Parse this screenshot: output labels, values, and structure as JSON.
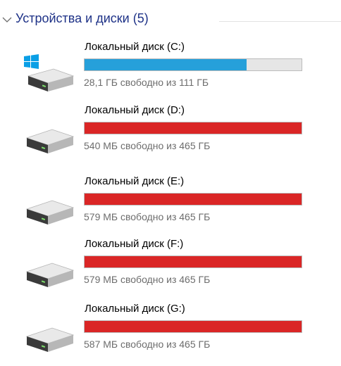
{
  "group": {
    "title": "Устройства и диски (5)",
    "expanded": true
  },
  "colors": {
    "bar_normal": "#26a0da",
    "bar_critical": "#da2626",
    "bar_track": "#e6e6e6",
    "group_title": "#1e3287",
    "free_text": "#6d6d6d"
  },
  "drives": [
    {
      "label": "Локальный диск (C:)",
      "free_text": "28,1 ГБ свободно из 111 ГБ",
      "used_fraction": 0.747,
      "status": "normal",
      "icon": "windows-system-drive-icon"
    },
    {
      "label": "Локальный диск (D:)",
      "free_text": "540 МБ свободно из 465 ГБ",
      "used_fraction": 0.999,
      "status": "critical",
      "icon": "hard-drive-icon"
    },
    {
      "label": "Локальный диск (E:)",
      "free_text": "579 МБ свободно из 465 ГБ",
      "used_fraction": 0.999,
      "status": "critical",
      "icon": "hard-drive-icon"
    },
    {
      "label": "Локальный диск (F:)",
      "free_text": "579 МБ свободно из 465 ГБ",
      "used_fraction": 0.999,
      "status": "critical",
      "icon": "hard-drive-icon"
    },
    {
      "label": "Локальный диск (G:)",
      "free_text": "587 МБ свободно из 465 ГБ",
      "used_fraction": 0.999,
      "status": "critical",
      "icon": "hard-drive-icon"
    }
  ]
}
